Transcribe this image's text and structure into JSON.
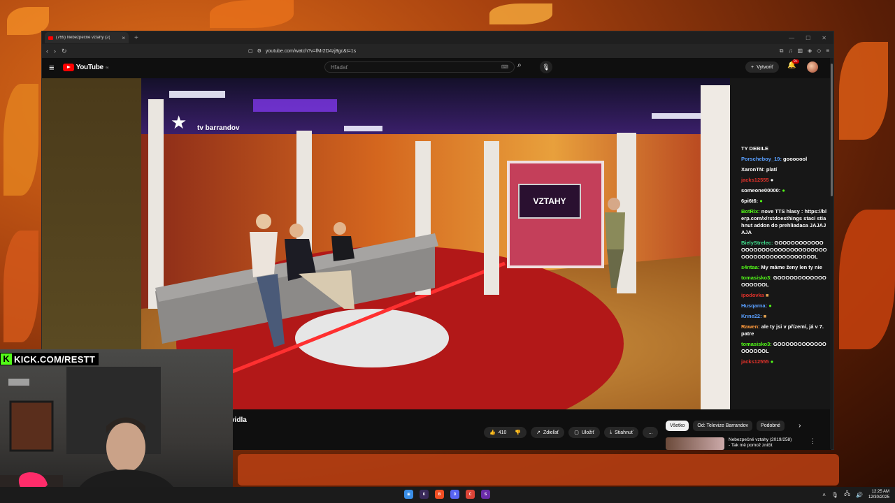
{
  "colors": {
    "accent": "#ff0000",
    "kick": "#53fc18",
    "background": "#0f0f0f"
  },
  "browser": {
    "tab_title": "(769) Nebezpečné vztahy (2(",
    "tab_close": "×",
    "new_tab": "+",
    "url": "youtube.com/watch?v=fMr2D4zj8gc&t=1s"
  },
  "youtube": {
    "logo_text": "YouTube",
    "logo_region": "SK",
    "search_placeholder": "Hľadať",
    "create_label": "Vytvoriť",
    "notification_count": "9+",
    "video_title_fragment": "vidla",
    "actions": {
      "like_count": "410",
      "share_label": "Zdieľať",
      "save_label": "Uložiť",
      "download_label": "Stiahnuť",
      "more": "..."
    },
    "chips": [
      "Všetko",
      "Od: Televize Barrandov",
      "Podobné"
    ],
    "recommendation": {
      "title": "Nebezpečné vztahy (2019/258)",
      "subtitle": "- Tak mě pomož zničit"
    }
  },
  "video": {
    "channel_logo": "tv barrandov",
    "screen_text": "VZTAHY"
  },
  "chat": {
    "header": "TY DEBILE",
    "messages": [
      {
        "user": "Porscheboy_19:",
        "text": "gooooool",
        "color": "#5aa0ff"
      },
      {
        "user": "XaronTN:",
        "text": "platí",
        "color": "#ffffff"
      },
      {
        "user": "jacks12555",
        "text": "",
        "color": "#e0322a"
      },
      {
        "user": "someone00000:",
        "text": "",
        "color": "#ffffff"
      },
      {
        "user": "6pi6t6:",
        "text": "",
        "color": "#ffffff"
      },
      {
        "user": "BotRix:",
        "text": "nove TTS hlasy : https://blerp.com/x/rstdoesthings staci stiahnut addon do prehliadaca JAJAJAJA",
        "color": "#53fc18"
      },
      {
        "user": "BielyStrelec:",
        "text": "GOOOOOOOOOOOOOOOOOOOOOOOOOOOOOOOOOOOOOOOOOOOOOOOOOOL",
        "color": "#3fd98a"
      },
      {
        "user": "s4ntaa:",
        "text": "My máme ženy len ty nie",
        "color": "#53fc18"
      },
      {
        "user": "tomasisko3:",
        "text": "GOOOOOOOOOOOOOOOOOOL",
        "color": "#53fc18"
      },
      {
        "user": "ipodovka",
        "text": "",
        "color": "#e0322a"
      },
      {
        "user": "Husqarna:",
        "text": "",
        "color": "#5aa0ff"
      },
      {
        "user": "Knne22:",
        "text": "",
        "color": "#5aa0ff"
      },
      {
        "user": "Rawen:",
        "text": "ale ty jsi v přízemí, já v 7. patre",
        "color": "#ff9a3c"
      },
      {
        "user": "tomasisko3:",
        "text": "GOOOOOOOOOOOOOOOOOOL",
        "color": "#53fc18"
      },
      {
        "user": "jacks12555",
        "text": "",
        "color": "#e0322a"
      }
    ]
  },
  "overlay": {
    "kick_logo": "K",
    "kick_text": "KICK.COM/RESTT"
  },
  "taskbar": {
    "time": "12:25 AM",
    "date": "12/30/2025"
  }
}
